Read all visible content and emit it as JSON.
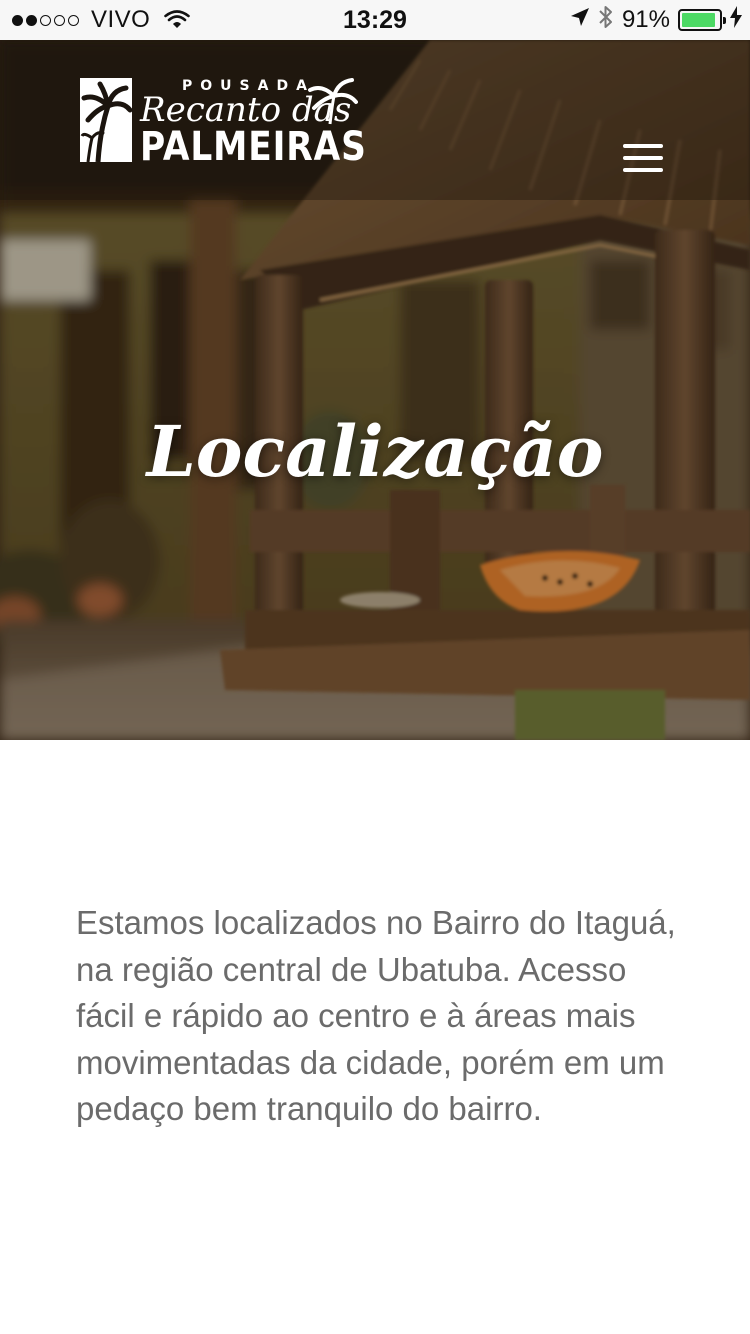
{
  "status_bar": {
    "signal_strength": 2,
    "signal_max": 5,
    "carrier": "VIVO",
    "wifi_icon": "wifi-icon",
    "time": "13:29",
    "location_icon": "location-arrow-icon",
    "bluetooth_icon": "bluetooth-icon",
    "battery_percent": "91%",
    "battery_level": 0.91,
    "charging_icon": "charging-bolt-icon",
    "colors": {
      "background": "#f7f7f7",
      "battery_fill": "#4cd964"
    }
  },
  "header": {
    "logo": {
      "line1": "POUSADA",
      "line2": "Recanto das",
      "line3": "PALMEIRAS",
      "icon": "palm-tree-icon"
    },
    "menu_icon": "hamburger-menu-icon"
  },
  "hero": {
    "title": "Localização",
    "image_subject": "wooden bird feeder with papaya"
  },
  "main": {
    "intro_text": "Estamos localizados no Bairro do Itaguá, na região central de Ubatuba. Acesso fácil e rápido ao centro e à áreas mais movimentadas da cidade, porém em um pedaço bem tranquilo do bairro.",
    "text_color": "#6b6b6b"
  }
}
